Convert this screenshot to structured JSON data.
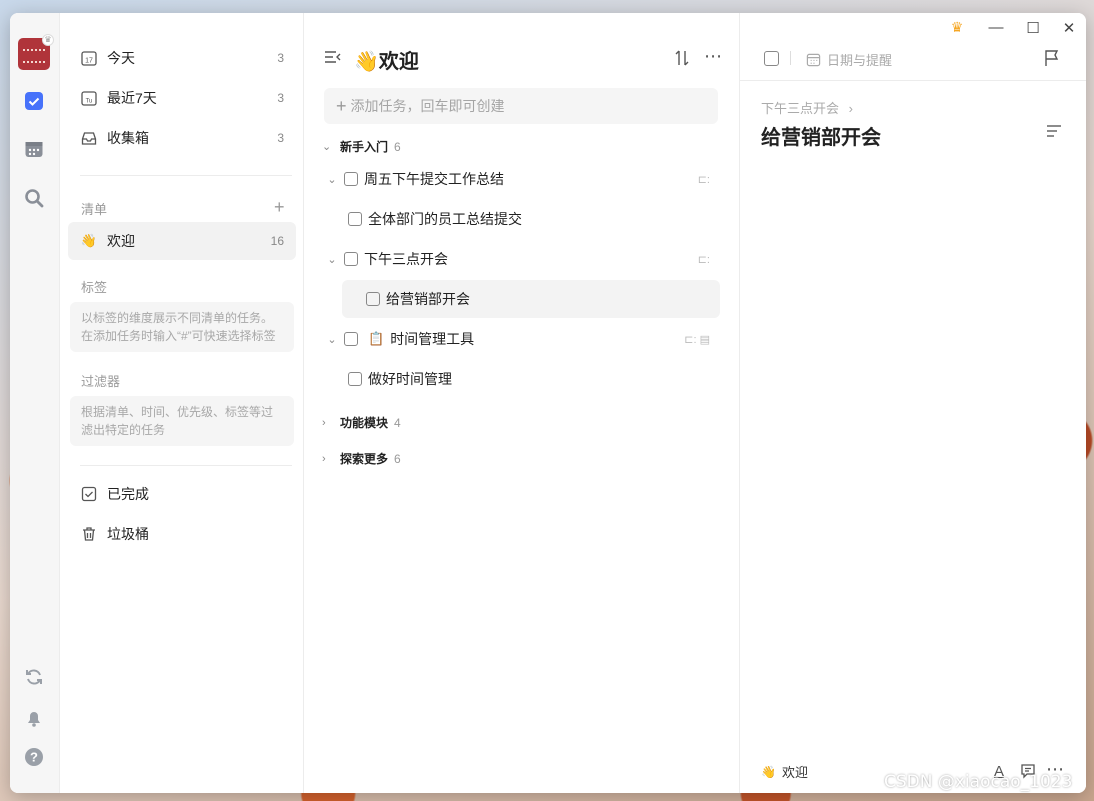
{
  "sidebar": {
    "nav": [
      {
        "label": "今天",
        "count": "3",
        "icon": "calendar-17-icon"
      },
      {
        "label": "最近7天",
        "count": "3",
        "icon": "calendar-week-icon"
      },
      {
        "label": "收集箱",
        "count": "3",
        "icon": "inbox-icon"
      }
    ],
    "lists_title": "清单",
    "lists": [
      {
        "emoji": "👋",
        "label": "欢迎",
        "count": "16"
      }
    ],
    "tags_title": "标签",
    "tags_hint": "以标签的维度展示不同清单的任务。在添加任务时输入“#”可快速选择标签",
    "filters_title": "过滤器",
    "filters_hint": "根据清单、时间、优先级、标签等过滤出特定的任务",
    "completed": "已完成",
    "trash": "垃圾桶"
  },
  "main": {
    "title_emoji": "👋",
    "title": "欢迎",
    "add_placeholder": "添加任务，回车即可创建",
    "groups": [
      {
        "name": "新手入门",
        "count": "6",
        "expanded": true
      },
      {
        "name": "功能模块",
        "count": "4",
        "expanded": false
      },
      {
        "name": "探索更多",
        "count": "6",
        "expanded": false
      }
    ],
    "tasks": [
      {
        "title": "周五下午提交工作总结",
        "level": 0
      },
      {
        "title": "全体部门的员工总结提交",
        "level": 1
      },
      {
        "title": "下午三点开会",
        "level": 0
      },
      {
        "title": "给营销部开会",
        "level": 1,
        "selected": true
      },
      {
        "title": "时间管理工具",
        "level": 0,
        "emoji": "📋"
      },
      {
        "title": "做好时间管理",
        "level": 1
      }
    ]
  },
  "detail": {
    "date_label": "日期与提醒",
    "breadcrumb": "下午三点开会",
    "title": "给营销部开会",
    "footer_emoji": "👋",
    "footer_list": "欢迎"
  },
  "watermark": "CSDN @xiaocao_1023",
  "colors": {
    "accent": "#4772fa",
    "avatar": "#b0343a",
    "crown": "#f5a623"
  }
}
